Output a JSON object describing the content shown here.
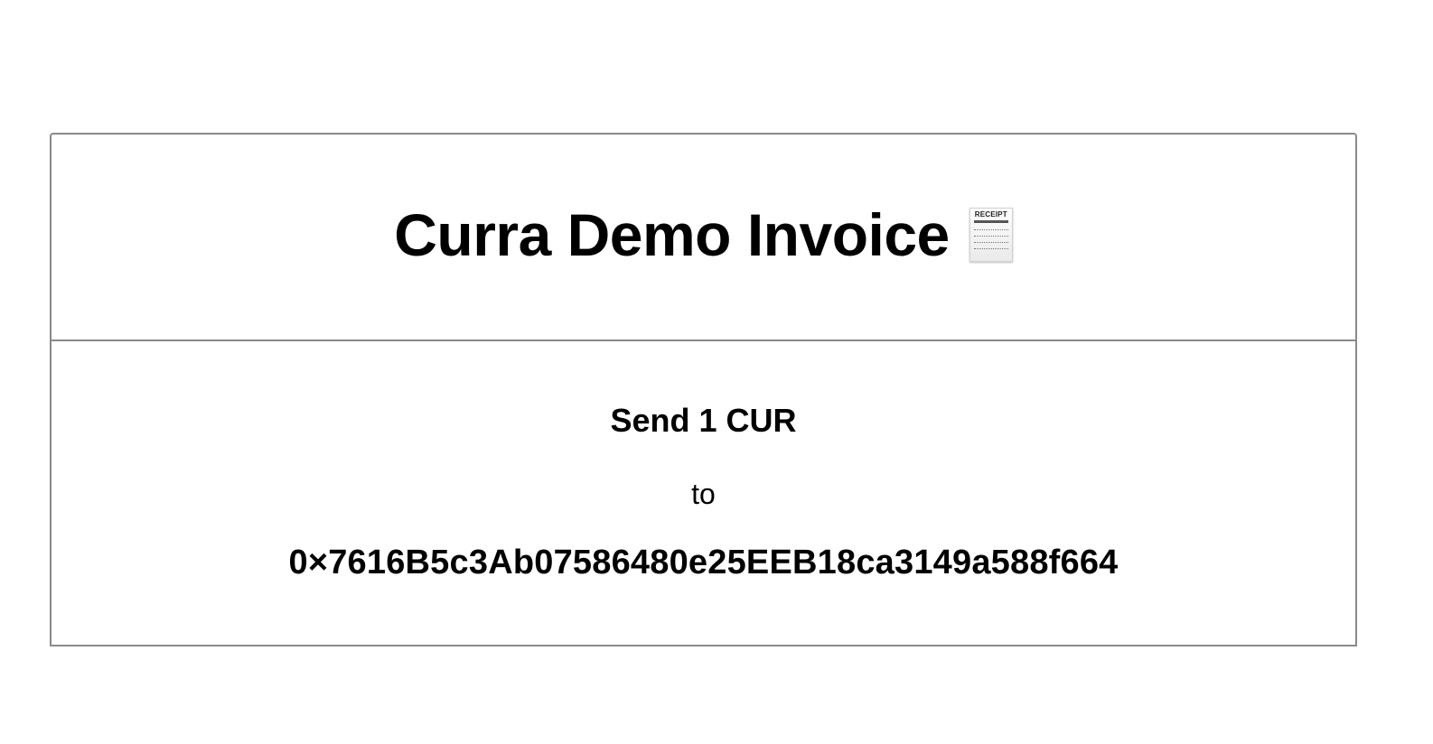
{
  "invoice": {
    "title": "Curra Demo Invoice",
    "title_icon": "receipt-icon",
    "receipt_icon_label": "RECEIPT",
    "send_text": "Send 1 CUR",
    "to_text": "to",
    "address": "0×7616B5c3Ab07586480e25EEB18ca3149a588f664"
  },
  "colors": {
    "border": "#8a8a8a",
    "text": "#000000",
    "background": "#ffffff"
  }
}
